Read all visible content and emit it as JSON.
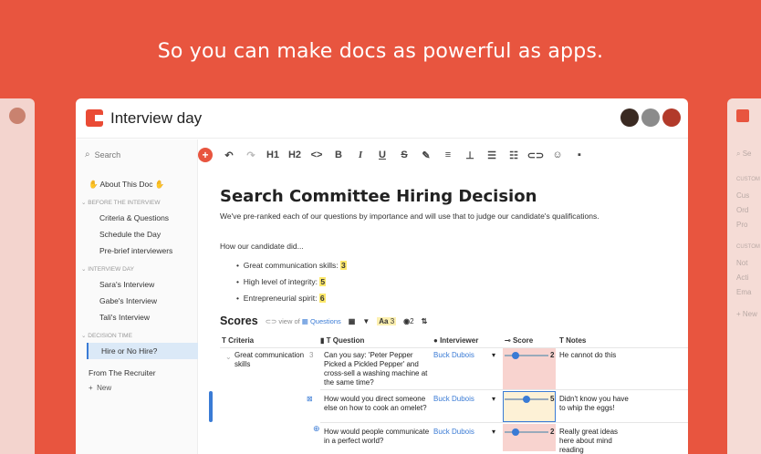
{
  "headline": "So you can make docs as powerful as apps.",
  "window": {
    "title": "Interview day"
  },
  "sidebar": {
    "search_placeholder": "Search",
    "about": "About This Doc",
    "sec1": "Before the interview",
    "sec1_items": [
      "Criteria & Questions",
      "Schedule the Day",
      "Pre-brief interviewers"
    ],
    "sec2": "Interview day",
    "sec2_items": [
      "Sara's Interview",
      "Gabe's Interview",
      "Tali's Interview"
    ],
    "sec3": "Decision time",
    "sec3_items": [
      "Hire or No Hire?"
    ],
    "recruiter": "From The Recruiter",
    "new": "New"
  },
  "toolbar": {
    "items": [
      "undo-icon",
      "redo-icon",
      "H1",
      "H2",
      "<>",
      "B",
      "I",
      "U",
      "S",
      "highlight",
      "align",
      "valign",
      "bullets",
      "numbers",
      "link",
      "emoji",
      "comment"
    ]
  },
  "doc": {
    "title": "Search Committee Hiring Decision",
    "intro": "We've pre-ranked each of our questions by importance and will use that to judge our candidate's qualifications.",
    "how": "How our candidate did...",
    "bullets": [
      {
        "label": "Great communication skills:",
        "value": "3"
      },
      {
        "label": "High level of integrity:",
        "value": "5"
      },
      {
        "label": "Entrepreneurial spirit:",
        "value": "6"
      }
    ],
    "scores": {
      "heading": "Scores",
      "view_of": "view of",
      "questions": "Questions",
      "aa_count": "3",
      "eye_count": "2"
    },
    "columns": [
      "Criteria",
      "Question",
      "Interviewer",
      "Score",
      "Notes"
    ],
    "rows": [
      {
        "criteria": "Great communication skills",
        "count": "3",
        "question": "Can you say: 'Peter Pepper Picked a Pickled Pepper' and cross-sell a washing machine at the same time?",
        "interviewer": "Buck Dubois",
        "score": "2",
        "notes": "He cannot do this"
      },
      {
        "criteria": "",
        "count": "",
        "question": "How would you direct someone else on how to cook an omelet?",
        "interviewer": "Buck Dubois",
        "score": "5",
        "notes": "Didn't know you have to whip the eggs!"
      },
      {
        "criteria": "",
        "count": "",
        "question": "How would people communicate in a perfect world?",
        "interviewer": "Buck Dubois",
        "score": "2",
        "notes": "Really great ideas here about mind reading"
      }
    ]
  },
  "ghost_right": {
    "search": "Se",
    "custom": "CUSTOM",
    "items": [
      "Cus",
      "Ord",
      "Pro"
    ],
    "custom2": "CUSTOM",
    "items2": [
      "Not",
      "Acti",
      "Ema"
    ],
    "new": "New"
  },
  "colors": {
    "brand": "#e8553f",
    "accent": "#3a7bd5",
    "highlight": "#fde86b"
  }
}
